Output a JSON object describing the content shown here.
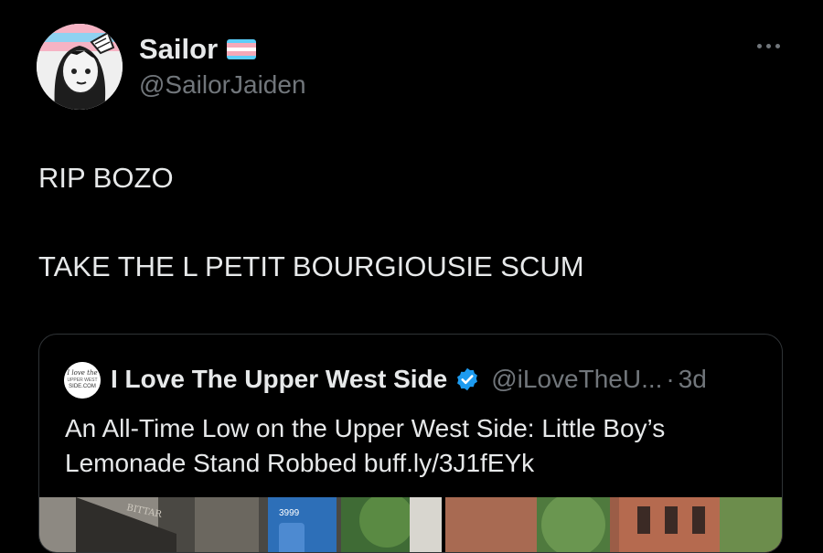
{
  "author": {
    "display_name": "Sailor",
    "handle": "@SailorJaiden",
    "flag_colors": [
      "#5bcefa",
      "#f5a9b8",
      "#ffffff",
      "#f5a9b8",
      "#5bcefa"
    ]
  },
  "tweet": {
    "lines": [
      "RIP BOZO",
      "TAKE THE L PETIT BOURGIOUSIE SCUM"
    ]
  },
  "quoted": {
    "avatar_text": [
      "I love the",
      "UPPER WEST",
      "SIDE.COM"
    ],
    "name": "I Love The Upper West Side",
    "handle": "@iLoveTheU...",
    "separator": "·",
    "time": "3d",
    "text_lines": [
      "An All-Time Low on the Upper West Side: Little Boy’s",
      "Lemonade Stand Robbed buff.ly/3J1fEYk"
    ],
    "media_text": [
      "BITTAR",
      "3999"
    ]
  },
  "icons": {
    "more": "more-horizontal-icon",
    "verified": "verified-badge-icon"
  },
  "colors": {
    "background": "#000000",
    "primary_text": "#e7e9ea",
    "secondary_text": "#71767b",
    "verified_blue": "#1d9bf0",
    "border": "#2f3336"
  }
}
